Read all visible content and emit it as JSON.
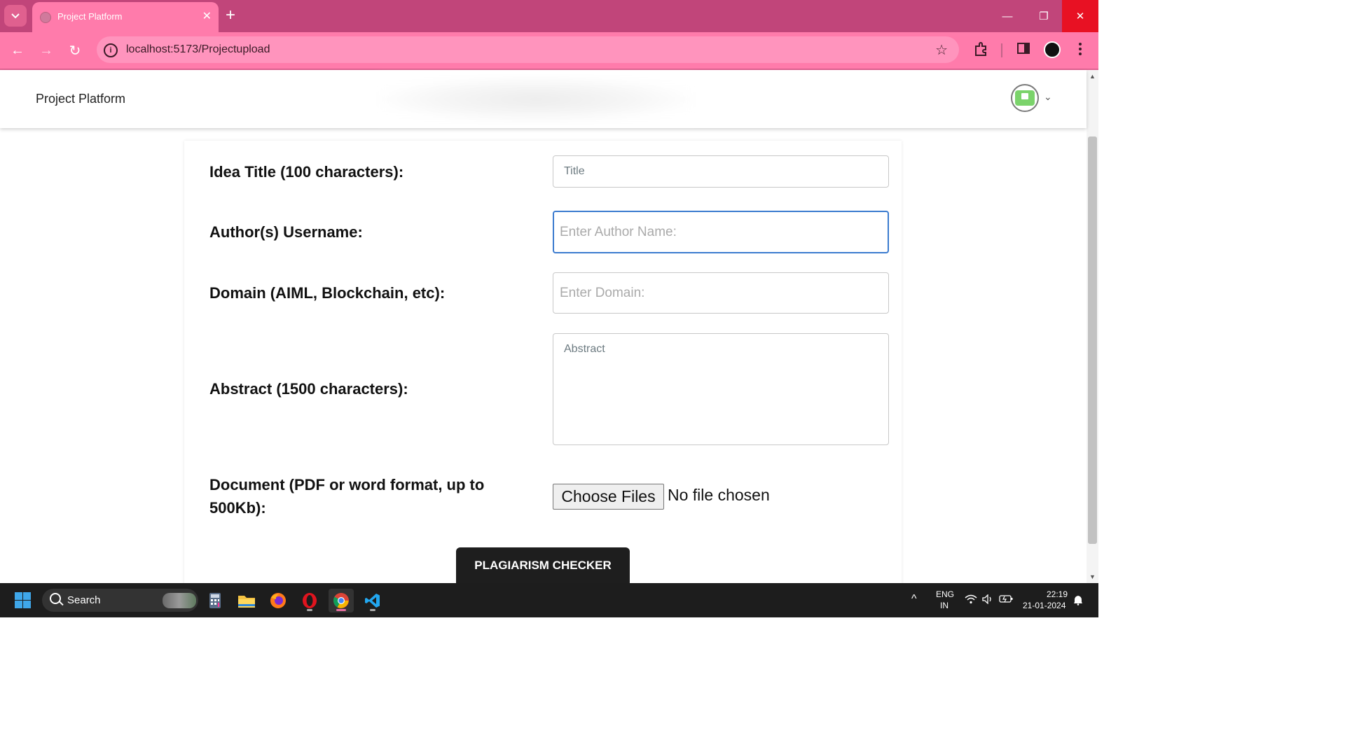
{
  "browser": {
    "tab_title": "Project Platform",
    "tab_close": "✕",
    "new_tab": "+",
    "url": "localhost:5173/Projectupload",
    "minimize": "—",
    "maximize": "❐",
    "close": "✕",
    "back": "←",
    "forward": "→",
    "reload": "↻",
    "star": "☆"
  },
  "app": {
    "brand": "Project Platform",
    "avatar_chevron": "⌄"
  },
  "form": {
    "title": {
      "label": "Idea Title (100 characters):",
      "placeholder": "Title"
    },
    "author": {
      "label": "Author(s) Username:",
      "placeholder": "Enter Author Name:"
    },
    "domain": {
      "label": "Domain (AIML, Blockchain, etc):",
      "placeholder": "Enter Domain:"
    },
    "abstract": {
      "label": "Abstract (1500 characters):",
      "placeholder": "Abstract"
    },
    "document": {
      "label": "Document (PDF or word format, up to 500Kb):",
      "button": "Choose Files",
      "status": "No file chosen"
    },
    "submit": "PLAGIARISM CHECKER"
  },
  "taskbar": {
    "search": "Search",
    "lang_top": "ENG",
    "lang_bottom": "IN",
    "time": "22:19",
    "date": "21-01-2024",
    "chevron_up": "^"
  },
  "colors": {
    "tabstrip": "#c1457a",
    "toolbar": "#ff7bab",
    "focus_border": "#3b7bcf",
    "button_dark": "#1e1e1e"
  }
}
